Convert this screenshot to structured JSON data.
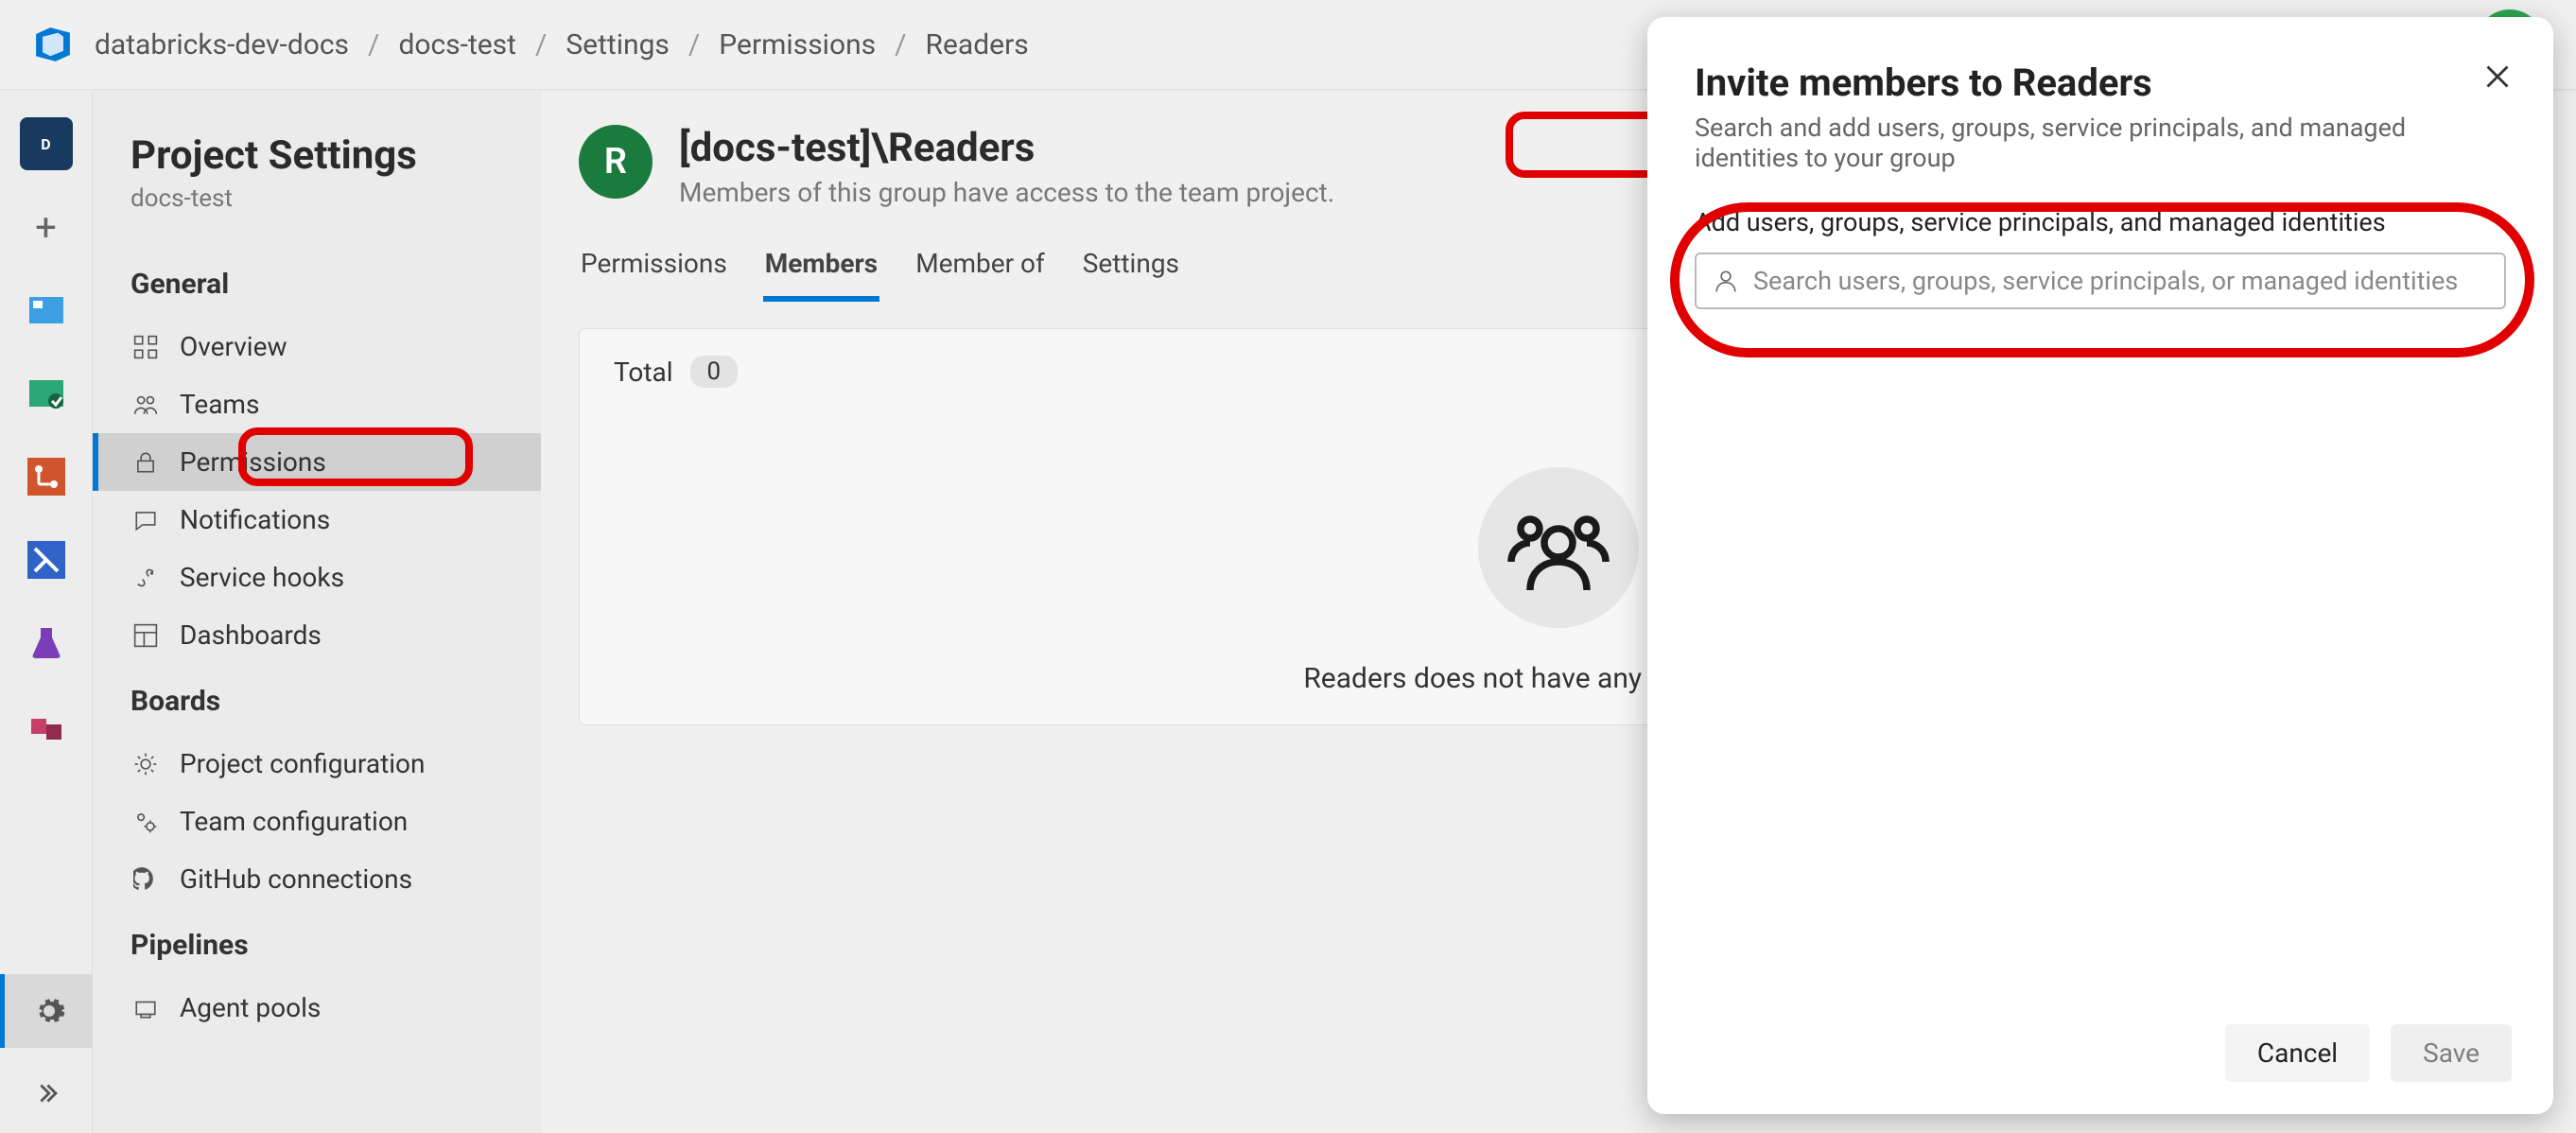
{
  "breadcrumb": [
    "databricks-dev-docs",
    "docs-test",
    "Settings",
    "Permissions",
    "Readers"
  ],
  "sidebar": {
    "title": "Project Settings",
    "subtitle": "docs-test",
    "sections": {
      "general": {
        "header": "General",
        "items": [
          {
            "label": "Overview"
          },
          {
            "label": "Teams"
          },
          {
            "label": "Permissions"
          },
          {
            "label": "Notifications"
          },
          {
            "label": "Service hooks"
          },
          {
            "label": "Dashboards"
          }
        ]
      },
      "boards": {
        "header": "Boards",
        "items": [
          {
            "label": "Project configuration"
          },
          {
            "label": "Team configuration"
          },
          {
            "label": "GitHub connections"
          }
        ]
      },
      "pipelines": {
        "header": "Pipelines",
        "items": [
          {
            "label": "Agent pools"
          }
        ]
      }
    }
  },
  "group": {
    "avatar_letter": "R",
    "title": "[docs-test]\\Readers",
    "subtitle": "Members of this group have access to the team project."
  },
  "tabs": {
    "permissions": "Permissions",
    "members": "Members",
    "memberof": "Member of",
    "settings": "Settings"
  },
  "members": {
    "total_label": "Total",
    "total_count": "0",
    "empty_text": "Readers does not have any members yet"
  },
  "dialog": {
    "title": "Invite members to Readers",
    "subtitle": "Search and add users, groups, service principals, and managed identities to your group",
    "field_label": "Add users, groups, service principals, and managed identities",
    "placeholder": "Search users, groups, service principals, or managed identities",
    "cancel": "Cancel",
    "save": "Save"
  }
}
